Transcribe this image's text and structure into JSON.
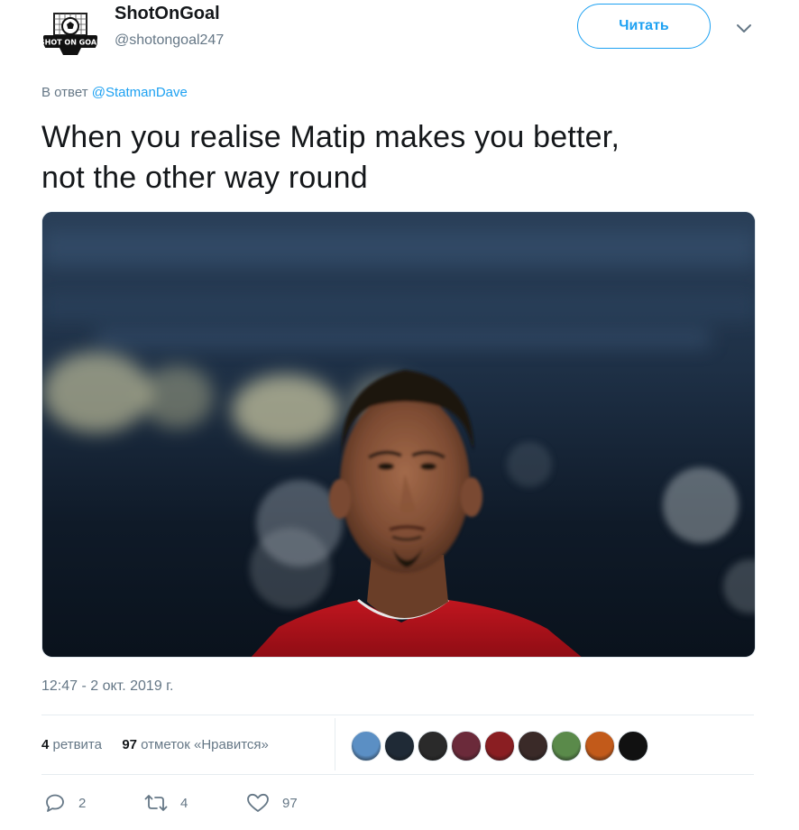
{
  "author": {
    "display_name": "ShotOnGoal",
    "handle": "@shotongoal247",
    "avatar_text": "SHOT ON GOAL"
  },
  "follow_button": {
    "label": "Читать"
  },
  "menu": {
    "icon": "chevron-down-icon"
  },
  "reply": {
    "prefix": "В ответ",
    "mention": "@StatmanDave"
  },
  "tweet": {
    "text_line1": "When you realise Matip makes you better,",
    "text_line2": "not the other way round"
  },
  "timestamp": "12:47 - 2 окт. 2019 г.",
  "stats": {
    "retweets_count": "4",
    "retweets_label": "ретвита",
    "likes_count": "97",
    "likes_label": "отметок «Нравится»"
  },
  "likers": [
    {
      "color": "#5b8fc4"
    },
    {
      "color": "#1f2a36"
    },
    {
      "color": "#2a2a2a"
    },
    {
      "color": "#6b2a3a"
    },
    {
      "color": "#8a1e22"
    },
    {
      "color": "#3a2a28"
    },
    {
      "color": "#5a8a4a"
    },
    {
      "color": "#c25a1a"
    },
    {
      "color": "#111111"
    }
  ],
  "actions": {
    "replies": "2",
    "retweets": "4",
    "likes": "97"
  },
  "colors": {
    "accent": "#1da1f2",
    "secondary_text": "#657786",
    "primary_text": "#14171a",
    "jersey_red": "#b4121c"
  }
}
